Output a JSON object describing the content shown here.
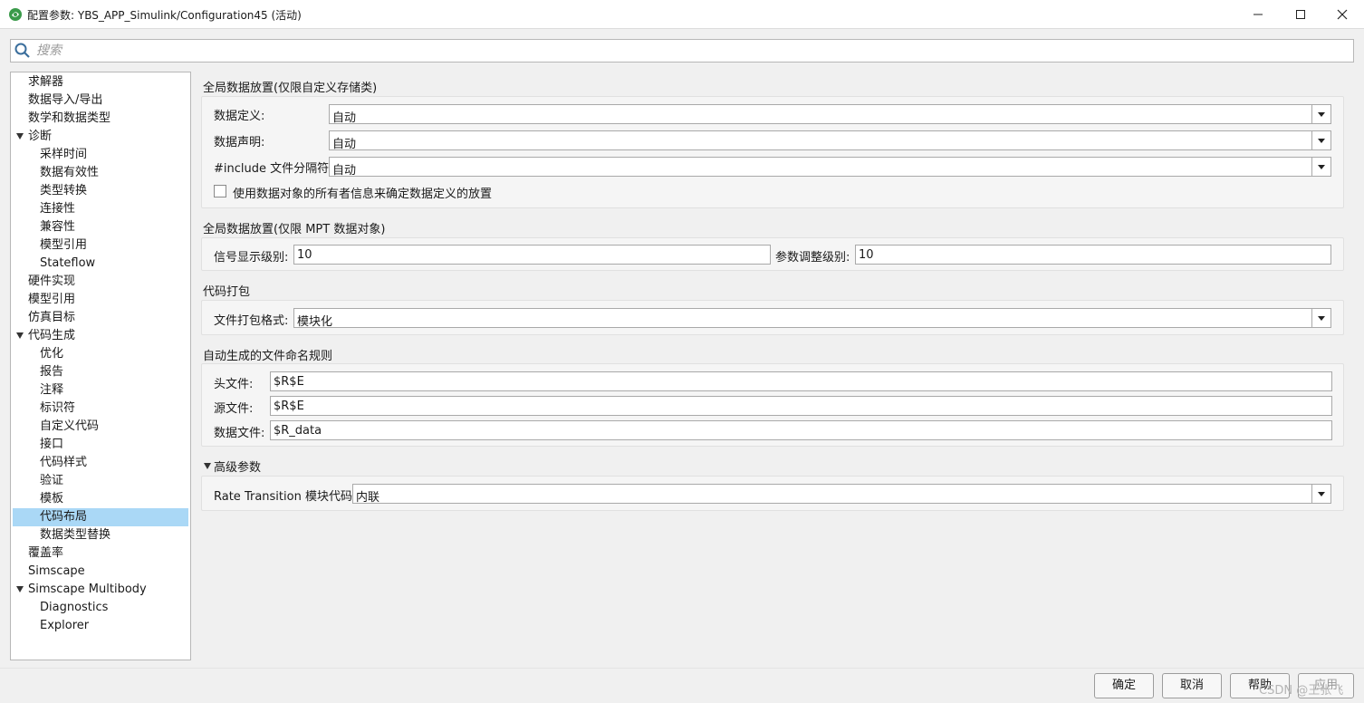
{
  "window": {
    "title": "配置参数: YBS_APP_Simulink/Configuration45 (活动)",
    "controls": [
      "minimize",
      "maximize",
      "close"
    ]
  },
  "search": {
    "placeholder": "搜索"
  },
  "tree": {
    "items": [
      {
        "label": "求解器",
        "level": 0,
        "expandable": false,
        "selected": false
      },
      {
        "label": "数据导入/导出",
        "level": 0,
        "expandable": false,
        "selected": false
      },
      {
        "label": "数学和数据类型",
        "level": 0,
        "expandable": false,
        "selected": false
      },
      {
        "label": "诊断",
        "level": 0,
        "expandable": true,
        "selected": false
      },
      {
        "label": "采样时间",
        "level": 1,
        "expandable": false,
        "selected": false
      },
      {
        "label": "数据有效性",
        "level": 1,
        "expandable": false,
        "selected": false
      },
      {
        "label": "类型转换",
        "level": 1,
        "expandable": false,
        "selected": false
      },
      {
        "label": "连接性",
        "level": 1,
        "expandable": false,
        "selected": false
      },
      {
        "label": "兼容性",
        "level": 1,
        "expandable": false,
        "selected": false
      },
      {
        "label": "模型引用",
        "level": 1,
        "expandable": false,
        "selected": false
      },
      {
        "label": "Stateflow",
        "level": 1,
        "expandable": false,
        "selected": false
      },
      {
        "label": "硬件实现",
        "level": 0,
        "expandable": false,
        "selected": false
      },
      {
        "label": "模型引用",
        "level": 0,
        "expandable": false,
        "selected": false
      },
      {
        "label": "仿真目标",
        "level": 0,
        "expandable": false,
        "selected": false
      },
      {
        "label": "代码生成",
        "level": 0,
        "expandable": true,
        "selected": false
      },
      {
        "label": "优化",
        "level": 1,
        "expandable": false,
        "selected": false
      },
      {
        "label": "报告",
        "level": 1,
        "expandable": false,
        "selected": false
      },
      {
        "label": "注释",
        "level": 1,
        "expandable": false,
        "selected": false
      },
      {
        "label": "标识符",
        "level": 1,
        "expandable": false,
        "selected": false
      },
      {
        "label": "自定义代码",
        "level": 1,
        "expandable": false,
        "selected": false
      },
      {
        "label": "接口",
        "level": 1,
        "expandable": false,
        "selected": false
      },
      {
        "label": "代码样式",
        "level": 1,
        "expandable": false,
        "selected": false
      },
      {
        "label": "验证",
        "level": 1,
        "expandable": false,
        "selected": false
      },
      {
        "label": "模板",
        "level": 1,
        "expandable": false,
        "selected": false
      },
      {
        "label": "代码布局",
        "level": 1,
        "expandable": false,
        "selected": true
      },
      {
        "label": "数据类型替换",
        "level": 1,
        "expandable": false,
        "selected": false
      },
      {
        "label": "覆盖率",
        "level": 0,
        "expandable": false,
        "selected": false
      },
      {
        "label": "Simscape",
        "level": 0,
        "expandable": false,
        "selected": false
      },
      {
        "label": "Simscape Multibody",
        "level": 0,
        "expandable": true,
        "selected": false
      },
      {
        "label": "Diagnostics",
        "level": 1,
        "expandable": false,
        "selected": false
      },
      {
        "label": "Explorer",
        "level": 1,
        "expandable": false,
        "selected": false
      }
    ]
  },
  "sections": {
    "global_custom": {
      "title": "全局数据放置(仅限自定义存储类)",
      "data_definition": {
        "label": "数据定义:",
        "value": "自动"
      },
      "data_declaration": {
        "label": "数据声明:",
        "value": "自动"
      },
      "include_delimiter": {
        "label": "#include 文件分隔符:",
        "value": "自动"
      },
      "owner_checkbox": {
        "label": "使用数据对象的所有者信息来确定数据定义的放置",
        "checked": false
      }
    },
    "global_mpt": {
      "title": "全局数据放置(仅限 MPT 数据对象)",
      "signal_level": {
        "label": "信号显示级别:",
        "value": "10"
      },
      "param_level": {
        "label": "参数调整级别:",
        "value": "10"
      }
    },
    "packaging": {
      "title": "代码打包",
      "file_format": {
        "label": "文件打包格式:",
        "value": "模块化"
      }
    },
    "naming": {
      "title": "自动生成的文件命名规则",
      "header_file": {
        "label": "头文件:",
        "value": "$R$E"
      },
      "source_file": {
        "label": "源文件:",
        "value": "$R$E"
      },
      "data_file": {
        "label": "数据文件:",
        "value": "$R_data"
      }
    },
    "advanced": {
      "title": "高级参数",
      "expanded": true,
      "rate_transition": {
        "label": "Rate Transition 模块代码:",
        "value": "内联"
      }
    }
  },
  "buttons": {
    "ok": "确定",
    "cancel": "取消",
    "help": "帮助",
    "apply": "应用"
  },
  "watermark": "CSDN @王张飞",
  "colors": {
    "selection": "#aad8f6",
    "background": "#f0f0f0",
    "panel": "#f5f5f5"
  }
}
